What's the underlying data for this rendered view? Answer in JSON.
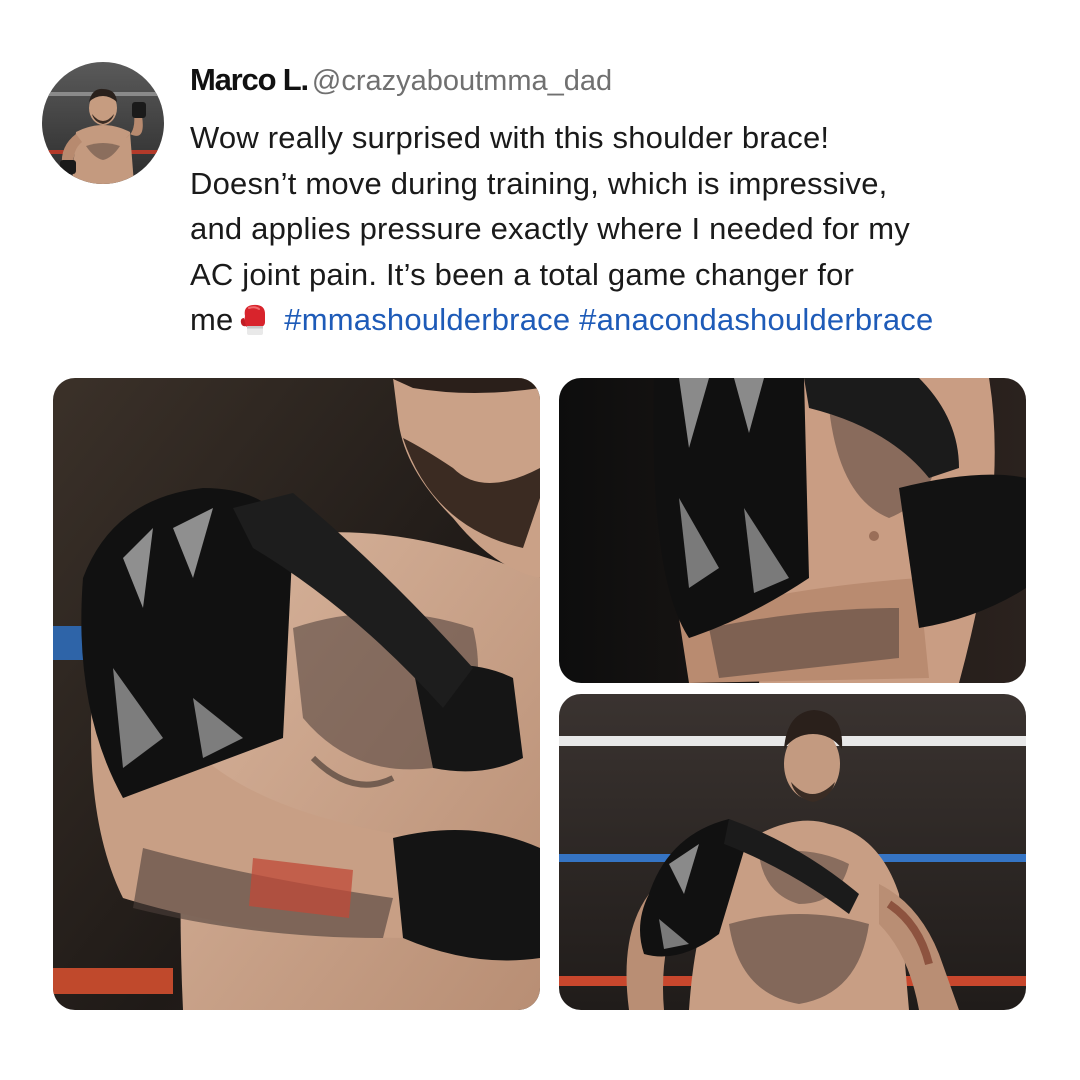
{
  "post": {
    "author": {
      "display_name": "Marco L.",
      "handle": "@crazyaboutmma_dad",
      "avatar_icon": "boxer-avatar"
    },
    "text_lines": [
      "Wow really surprised with this shoulder brace!",
      "Doesn’t move during training, which is impressive,",
      "and applies pressure exactly where I needed for my",
      "AC joint pain. It’s been a total game changer for"
    ],
    "last_line_text": "me",
    "emoji_icon": "boxing-glove-icon",
    "hashtags": [
      "#mmashoulderbrace",
      "#anacondashoulderbrace"
    ],
    "hashtag_color": "#1e5bb8"
  },
  "photos": [
    {
      "name": "photo-main",
      "subject": "man adjusting black shoulder brace strap, close-up"
    },
    {
      "name": "photo-top-right",
      "subject": "shoulder brace sleeve on tattooed arm, side view"
    },
    {
      "name": "photo-bottom-right",
      "subject": "man wearing shoulder brace in boxing ring"
    }
  ]
}
